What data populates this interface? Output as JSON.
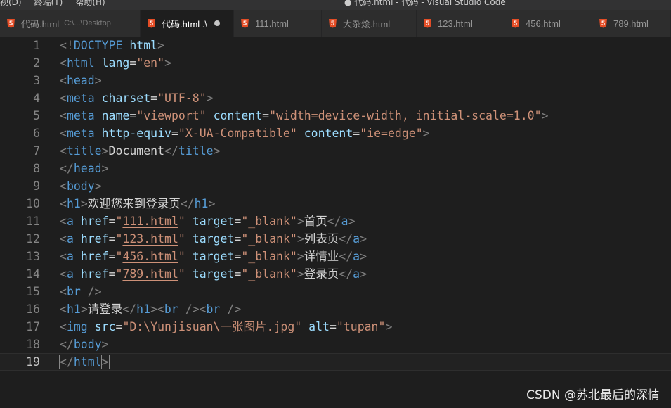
{
  "window": {
    "menus": [
      "视(D)",
      "终端(T)",
      "帮助(H)"
    ],
    "title": "● 代码.html - 代码 - Visual Studio Code"
  },
  "tabs": [
    {
      "label": "代码.html",
      "desc": "C:\\...\\Desktop",
      "active": false
    },
    {
      "label": "代码.html .\\",
      "dirty": true,
      "active": true
    },
    {
      "label": "111.html",
      "active": false
    },
    {
      "label": "大杂烩.html",
      "active": false
    },
    {
      "label": "123.html",
      "active": false
    },
    {
      "label": "456.html",
      "active": false
    },
    {
      "label": "789.html",
      "active": false
    }
  ],
  "editor": {
    "current_line": 19,
    "lines": [
      [
        [
          "p",
          "<!"
        ],
        [
          "t",
          "DOCTYPE"
        ],
        [
          "x",
          " "
        ],
        [
          "a",
          "html"
        ],
        [
          "p",
          ">"
        ]
      ],
      [
        [
          "p",
          "<"
        ],
        [
          "t",
          "html"
        ],
        [
          "x",
          " "
        ],
        [
          "a",
          "lang"
        ],
        [
          "x",
          "="
        ],
        [
          "s",
          "\"en\""
        ],
        [
          "p",
          ">"
        ]
      ],
      [
        [
          "p",
          "<"
        ],
        [
          "t",
          "head"
        ],
        [
          "p",
          ">"
        ]
      ],
      [
        [
          "p",
          "<"
        ],
        [
          "t",
          "meta"
        ],
        [
          "x",
          " "
        ],
        [
          "a",
          "charset"
        ],
        [
          "x",
          "="
        ],
        [
          "s",
          "\"UTF-8\""
        ],
        [
          "p",
          ">"
        ]
      ],
      [
        [
          "p",
          "<"
        ],
        [
          "t",
          "meta"
        ],
        [
          "x",
          " "
        ],
        [
          "a",
          "name"
        ],
        [
          "x",
          "="
        ],
        [
          "s",
          "\"viewport\""
        ],
        [
          "x",
          " "
        ],
        [
          "a",
          "content"
        ],
        [
          "x",
          "="
        ],
        [
          "s",
          "\"width=device-width, initial-scale=1.0\""
        ],
        [
          "p",
          ">"
        ]
      ],
      [
        [
          "p",
          "<"
        ],
        [
          "t",
          "meta"
        ],
        [
          "x",
          " "
        ],
        [
          "a",
          "http-equiv"
        ],
        [
          "x",
          "="
        ],
        [
          "s",
          "\"X-UA-Compatible\""
        ],
        [
          "x",
          " "
        ],
        [
          "a",
          "content"
        ],
        [
          "x",
          "="
        ],
        [
          "s",
          "\"ie=edge\""
        ],
        [
          "p",
          ">"
        ]
      ],
      [
        [
          "p",
          "<"
        ],
        [
          "t",
          "title"
        ],
        [
          "p",
          ">"
        ],
        [
          "x",
          "Document"
        ],
        [
          "p",
          "</"
        ],
        [
          "t",
          "title"
        ],
        [
          "p",
          ">"
        ]
      ],
      [
        [
          "p",
          "</"
        ],
        [
          "t",
          "head"
        ],
        [
          "p",
          ">"
        ]
      ],
      [
        [
          "p",
          "<"
        ],
        [
          "t",
          "body"
        ],
        [
          "p",
          ">"
        ]
      ],
      [
        [
          "p",
          "<"
        ],
        [
          "t",
          "h1"
        ],
        [
          "p",
          ">"
        ],
        [
          "x",
          "欢迎您来到登录页"
        ],
        [
          "p",
          "</"
        ],
        [
          "t",
          "h1"
        ],
        [
          "p",
          ">"
        ]
      ],
      [
        [
          "p",
          "<"
        ],
        [
          "t",
          "a"
        ],
        [
          "x",
          " "
        ],
        [
          "a",
          "href"
        ],
        [
          "x",
          "="
        ],
        [
          "s",
          "\""
        ],
        [
          "su",
          "111.html"
        ],
        [
          "s",
          "\""
        ],
        [
          "x",
          " "
        ],
        [
          "a",
          "target"
        ],
        [
          "x",
          "="
        ],
        [
          "s",
          "\"_blank\""
        ],
        [
          "p",
          ">"
        ],
        [
          "x",
          "首页"
        ],
        [
          "p",
          "</"
        ],
        [
          "t",
          "a"
        ],
        [
          "p",
          ">"
        ]
      ],
      [
        [
          "p",
          "<"
        ],
        [
          "t",
          "a"
        ],
        [
          "x",
          " "
        ],
        [
          "a",
          "href"
        ],
        [
          "x",
          "="
        ],
        [
          "s",
          "\""
        ],
        [
          "su",
          "123.html"
        ],
        [
          "s",
          "\""
        ],
        [
          "x",
          " "
        ],
        [
          "a",
          "target"
        ],
        [
          "x",
          "="
        ],
        [
          "s",
          "\"_blank\""
        ],
        [
          "p",
          ">"
        ],
        [
          "x",
          "列表页"
        ],
        [
          "p",
          "</"
        ],
        [
          "t",
          "a"
        ],
        [
          "p",
          ">"
        ]
      ],
      [
        [
          "p",
          "<"
        ],
        [
          "t",
          "a"
        ],
        [
          "x",
          " "
        ],
        [
          "a",
          "href"
        ],
        [
          "x",
          "="
        ],
        [
          "s",
          "\""
        ],
        [
          "su",
          "456.html"
        ],
        [
          "s",
          "\""
        ],
        [
          "x",
          " "
        ],
        [
          "a",
          "target"
        ],
        [
          "x",
          "="
        ],
        [
          "s",
          "\"_blank\""
        ],
        [
          "p",
          ">"
        ],
        [
          "x",
          "详情业"
        ],
        [
          "p",
          "</"
        ],
        [
          "t",
          "a"
        ],
        [
          "p",
          ">"
        ]
      ],
      [
        [
          "p",
          "<"
        ],
        [
          "t",
          "a"
        ],
        [
          "x",
          " "
        ],
        [
          "a",
          "href"
        ],
        [
          "x",
          "="
        ],
        [
          "s",
          "\""
        ],
        [
          "su",
          "789.html"
        ],
        [
          "s",
          "\""
        ],
        [
          "x",
          " "
        ],
        [
          "a",
          "target"
        ],
        [
          "x",
          "="
        ],
        [
          "s",
          "\"_blank\""
        ],
        [
          "p",
          ">"
        ],
        [
          "x",
          "登录页"
        ],
        [
          "p",
          "</"
        ],
        [
          "t",
          "a"
        ],
        [
          "p",
          ">"
        ]
      ],
      [
        [
          "p",
          "<"
        ],
        [
          "t",
          "br"
        ],
        [
          "x",
          " "
        ],
        [
          "p",
          "/>"
        ]
      ],
      [
        [
          "p",
          "<"
        ],
        [
          "t",
          "h1"
        ],
        [
          "p",
          ">"
        ],
        [
          "x",
          "请登录"
        ],
        [
          "p",
          "</"
        ],
        [
          "t",
          "h1"
        ],
        [
          "p",
          "><"
        ],
        [
          "t",
          "br"
        ],
        [
          "x",
          " "
        ],
        [
          "p",
          "/><"
        ],
        [
          "t",
          "br"
        ],
        [
          "x",
          " "
        ],
        [
          "p",
          "/>"
        ]
      ],
      [
        [
          "p",
          "<"
        ],
        [
          "t",
          "img"
        ],
        [
          "x",
          " "
        ],
        [
          "a",
          "src"
        ],
        [
          "x",
          "="
        ],
        [
          "s",
          "\""
        ],
        [
          "su",
          "D:\\Yunjisuan\\一张图片.jpg"
        ],
        [
          "s",
          "\""
        ],
        [
          "x",
          " "
        ],
        [
          "a",
          "alt"
        ],
        [
          "x",
          "="
        ],
        [
          "s",
          "\"tupan\""
        ],
        [
          "p",
          ">"
        ]
      ],
      [
        [
          "p",
          "</"
        ],
        [
          "t",
          "body"
        ],
        [
          "p",
          ">"
        ]
      ],
      [
        [
          "pb",
          "<"
        ],
        [
          "p",
          "/"
        ],
        [
          "t",
          "html"
        ],
        [
          "pb",
          ">"
        ]
      ]
    ]
  },
  "watermark": "CSDN @苏北最后的深情"
}
